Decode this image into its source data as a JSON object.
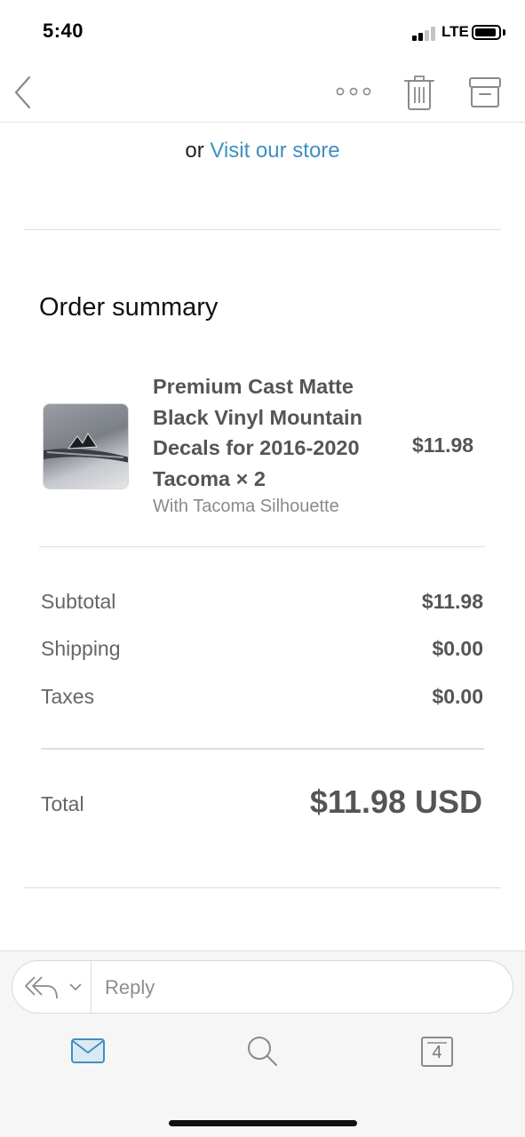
{
  "status_bar": {
    "time": "5:40",
    "network": "LTE"
  },
  "nav": {
    "icons": [
      "back-chevron-icon",
      "more-icon",
      "trash-icon",
      "archive-icon"
    ]
  },
  "store": {
    "prefix": "or",
    "link_text": "Visit our store",
    "link_color": "#3f90c0"
  },
  "order_summary": {
    "title": "Order summary",
    "item": {
      "name": "Premium Cast Matte Black Vinyl Mountain Decals for 2016-2020 Tacoma × 2",
      "variant": "With Tacoma Silhouette",
      "price": "$11.98"
    },
    "rows": [
      {
        "label": "Subtotal",
        "value": "$11.98"
      },
      {
        "label": "Shipping",
        "value": "$0.00"
      },
      {
        "label": "Taxes",
        "value": "$0.00"
      }
    ],
    "total": {
      "label": "Total",
      "value": "$11.98 USD"
    }
  },
  "bottom_bar": {
    "reply_placeholder": "Reply",
    "accent_color": "#3f90c0",
    "tabs": [
      "mail-icon",
      "search-icon",
      "calendar-icon"
    ],
    "calendar_day": "4"
  }
}
